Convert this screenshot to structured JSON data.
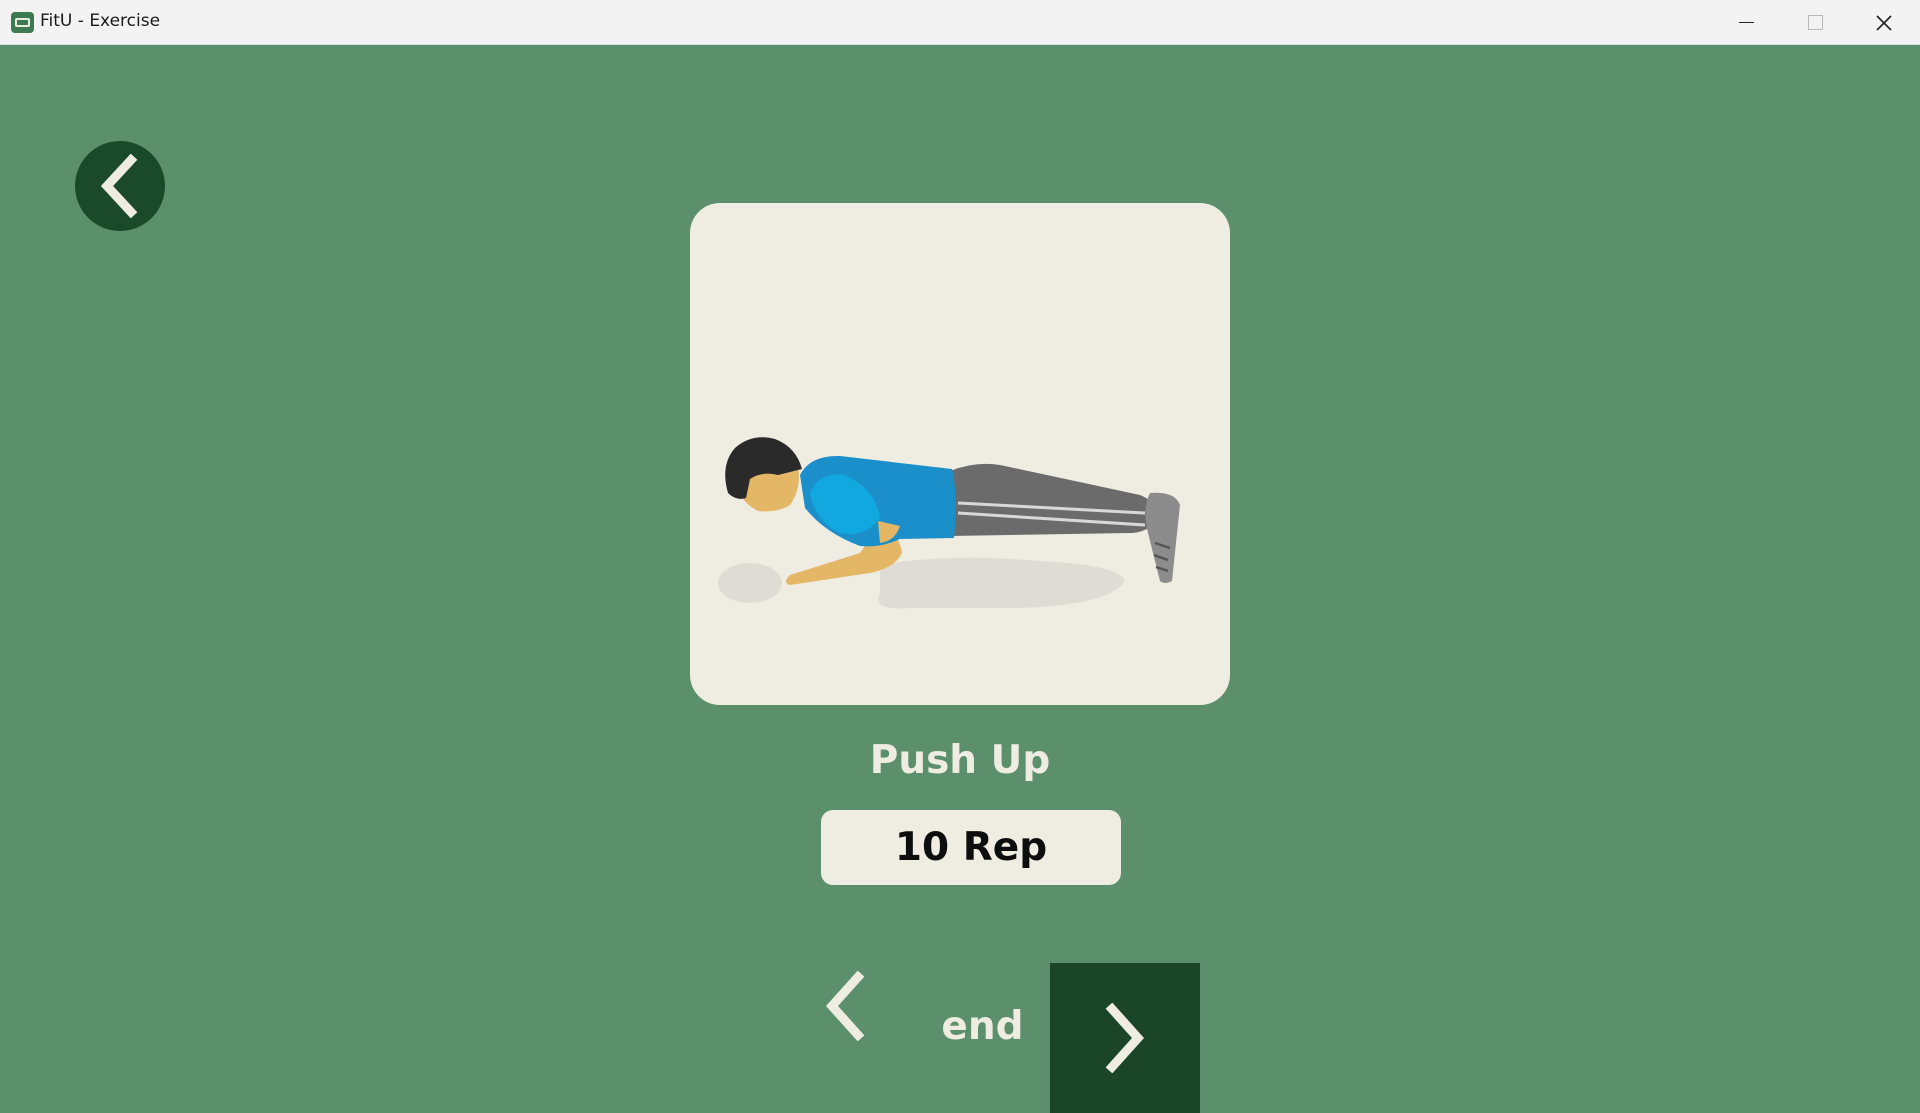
{
  "window": {
    "title": "FitU - Exercise"
  },
  "exercise": {
    "name": "Push Up",
    "reps_label": "10 Rep",
    "illustration_icon": "push-up-illustration"
  },
  "navigation": {
    "status_label": "end",
    "back_icon": "chevron-left-icon",
    "prev_icon": "chevron-left-icon",
    "next_icon": "chevron-right-icon"
  },
  "colors": {
    "background": "#5c8f6b",
    "dark_green": "#1a4528",
    "cream": "#efede2"
  }
}
